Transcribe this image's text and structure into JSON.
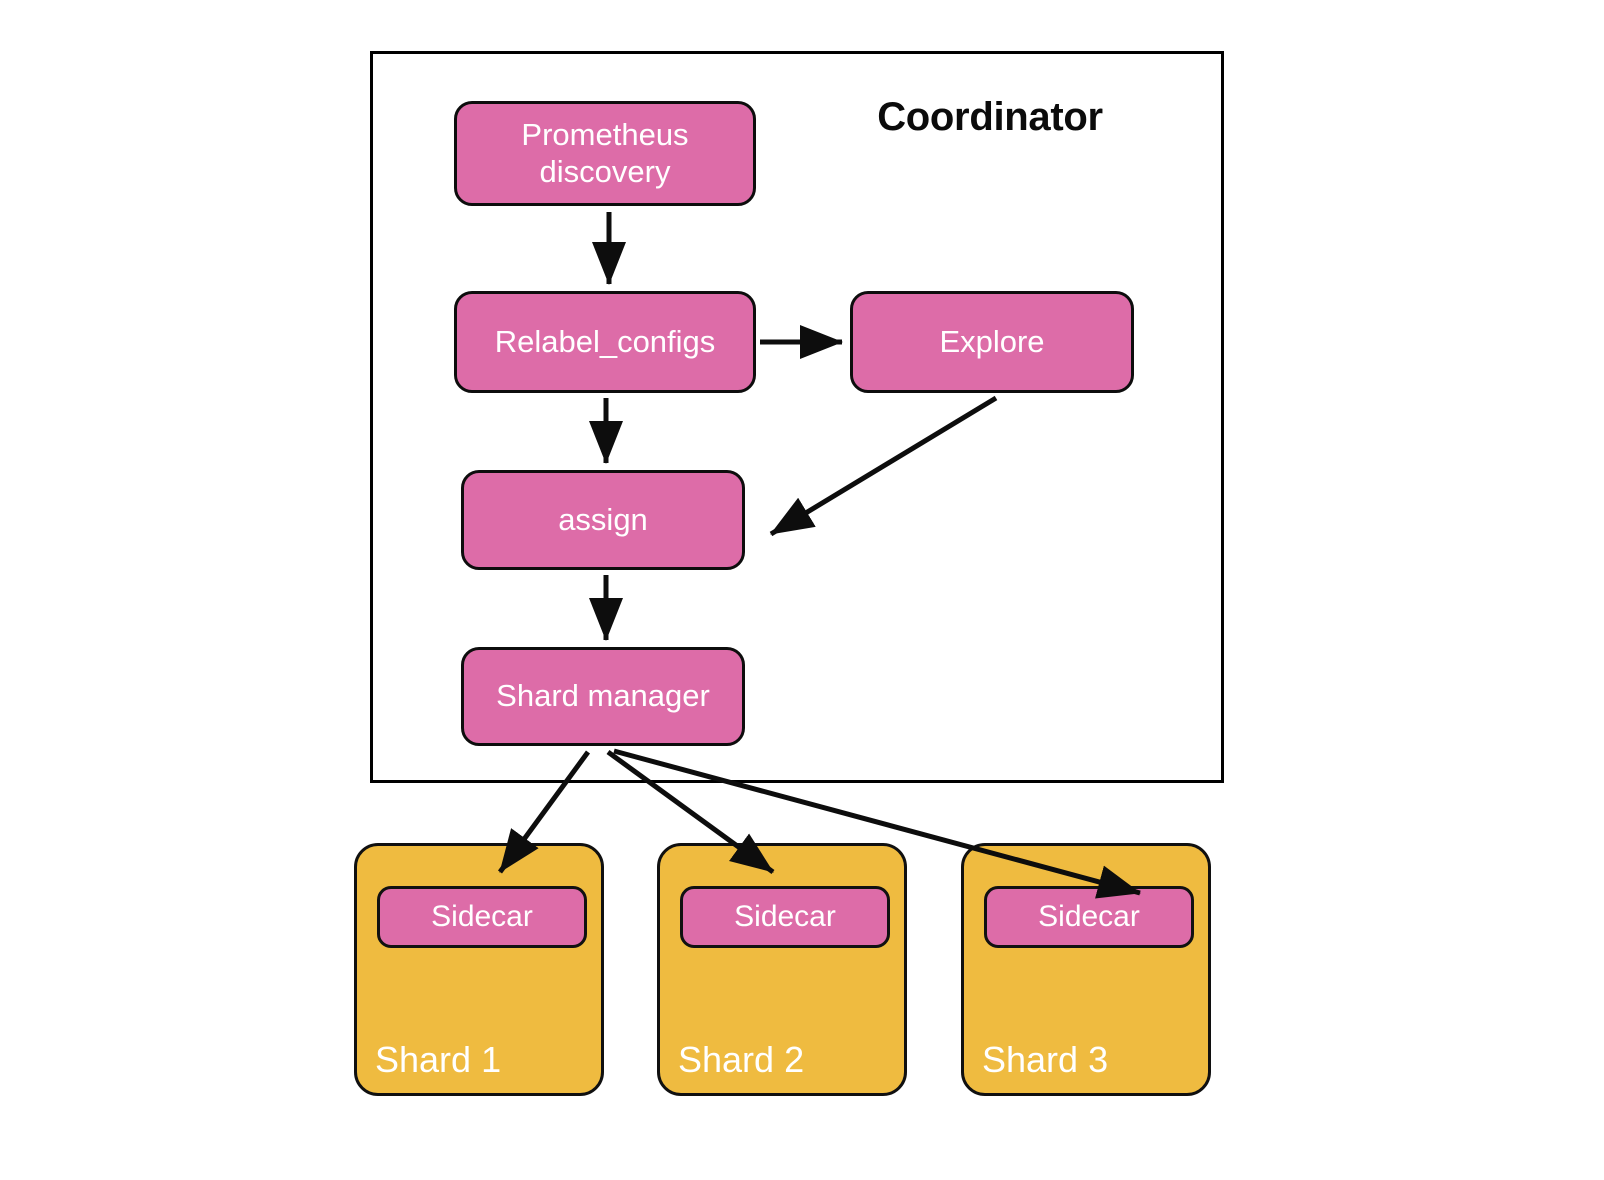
{
  "diagram": {
    "title": "Coordinator",
    "background": "#ffffff",
    "colors": {
      "node_pink": "#DD6CA8",
      "node_orange": "#EFBB40",
      "stroke": "#101010",
      "text_on_node": "#ffffff",
      "title_text": "#0b0b0b"
    }
  },
  "coordinator": {
    "title": "Coordinator",
    "nodes": {
      "prometheus_discovery": "Prometheus\ndiscovery",
      "prometheus_discovery_line1": "Prometheus",
      "prometheus_discovery_line2": "discovery",
      "relabel_configs": "Relabel_configs",
      "explore": "Explore",
      "assign": "assign",
      "shard_manager": "Shard manager"
    }
  },
  "shards": [
    {
      "label": "Shard 1",
      "sidecar": "Sidecar"
    },
    {
      "label": "Shard 2",
      "sidecar": "Sidecar"
    },
    {
      "label": "Shard 3",
      "sidecar": "Sidecar"
    }
  ],
  "edges": [
    {
      "from": "Prometheus discovery",
      "to": "Relabel_configs",
      "style": "straight-down"
    },
    {
      "from": "Relabel_configs",
      "to": "Explore",
      "style": "straight-right"
    },
    {
      "from": "Relabel_configs",
      "to": "assign",
      "style": "straight-down"
    },
    {
      "from": "Explore",
      "to": "assign",
      "style": "diagonal-down-left"
    },
    {
      "from": "assign",
      "to": "Shard manager",
      "style": "straight-down"
    },
    {
      "from": "Shard manager",
      "to": "Shard 1 Sidecar",
      "style": "diagonal-down-left"
    },
    {
      "from": "Shard manager",
      "to": "Shard 2 Sidecar",
      "style": "diagonal-down-right"
    },
    {
      "from": "Shard manager",
      "to": "Shard 3 Sidecar",
      "style": "diagonal-down-right"
    }
  ]
}
